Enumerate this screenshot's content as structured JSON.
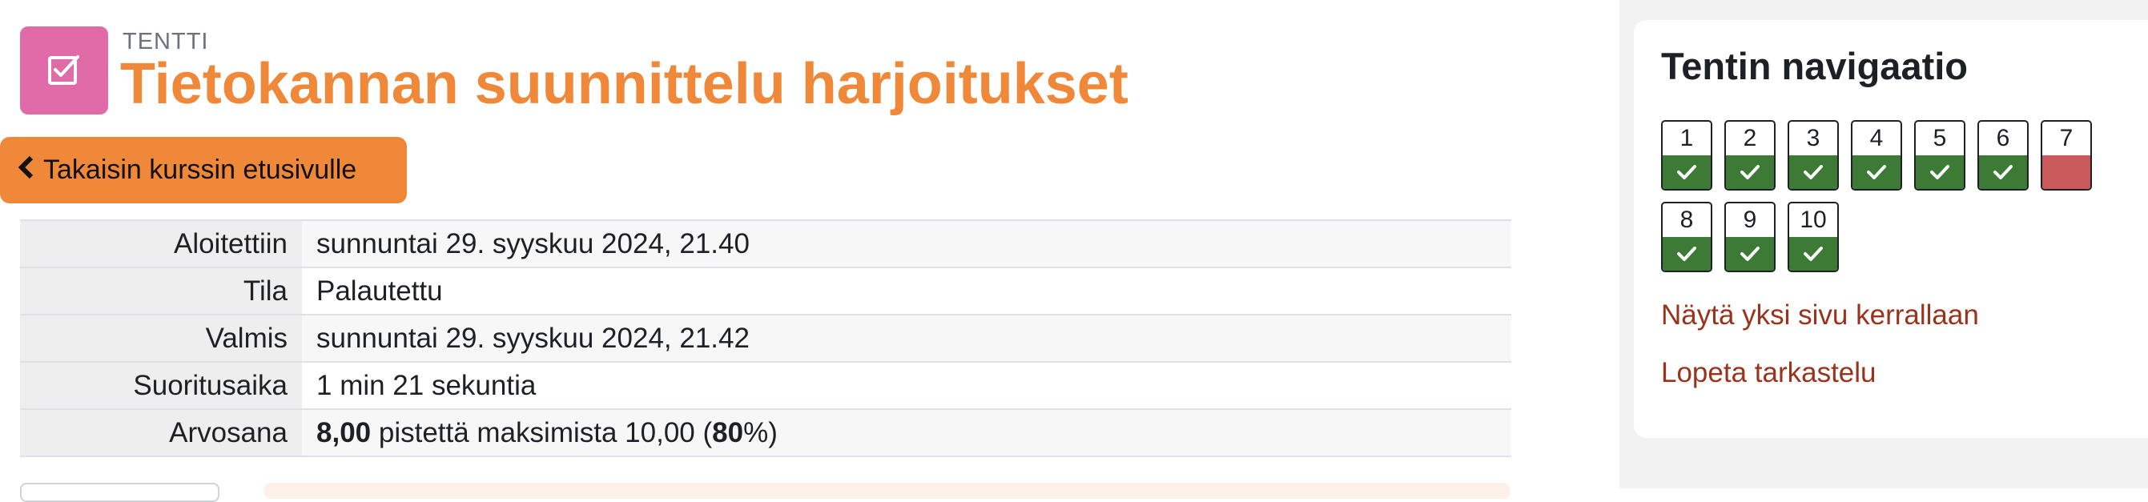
{
  "colors": {
    "accent": "#f0883a",
    "activity_icon_bg": "#e06ba6",
    "correct": "#3d7a35",
    "incorrect": "#c9595a",
    "link": "#99331c"
  },
  "header": {
    "activity_icon": "checkbox-pen-icon",
    "kicker": "TENTTI",
    "title": "Tietokannan suunnittelu harjoitukset"
  },
  "back_button": {
    "icon": "chevron-left-icon",
    "label": "Takaisin kurssin etusivulle"
  },
  "summary": {
    "rows": [
      {
        "label": "Aloitettiin",
        "value": "sunnuntai 29. syyskuu 2024, 21.40"
      },
      {
        "label": "Tila",
        "value": "Palautettu"
      },
      {
        "label": "Valmis",
        "value": "sunnuntai 29. syyskuu 2024, 21.42"
      },
      {
        "label": "Suoritusaika",
        "value": "1 min 21 sekuntia"
      },
      {
        "label": "Arvosana",
        "score": "8,00",
        "middle": "pistettä maksimista 10,00 (",
        "percent": "80",
        "suffix": "%)"
      }
    ]
  },
  "navigation": {
    "title": "Tentin navigaatio",
    "questions": [
      {
        "number": "1",
        "status": "correct"
      },
      {
        "number": "2",
        "status": "correct"
      },
      {
        "number": "3",
        "status": "correct"
      },
      {
        "number": "4",
        "status": "correct"
      },
      {
        "number": "5",
        "status": "correct"
      },
      {
        "number": "6",
        "status": "correct"
      },
      {
        "number": "7",
        "status": "incorrect"
      },
      {
        "number": "8",
        "status": "correct"
      },
      {
        "number": "9",
        "status": "correct"
      },
      {
        "number": "10",
        "status": "correct"
      }
    ],
    "links": {
      "show_one_page": "Näytä yksi sivu kerrallaan",
      "finish_review": "Lopeta tarkastelu"
    }
  }
}
